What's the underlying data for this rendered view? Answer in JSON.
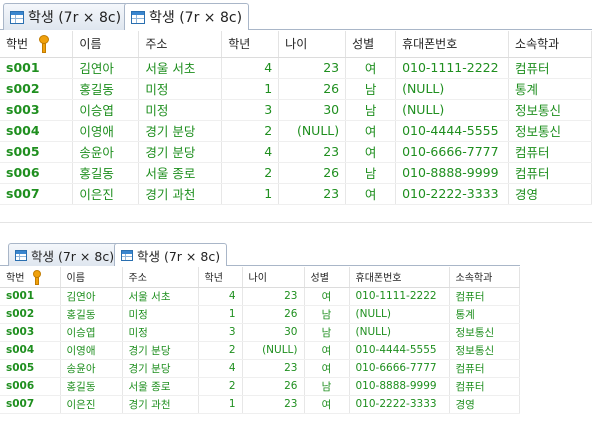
{
  "tabs": [
    {
      "label": "학생 (7r × 8c)",
      "active": false
    },
    {
      "label": "학생 (7r × 8c)",
      "active": true
    }
  ],
  "columns": [
    "학번",
    "이름",
    "주소",
    "학년",
    "나이",
    "성별",
    "휴대폰번호",
    "소속학과"
  ],
  "rows": [
    {
      "id": "s001",
      "name": "김연아",
      "address": "서울 서초",
      "grade": "4",
      "age": "23",
      "gender": "여",
      "phone": "010-1111-2222",
      "dept": "컴퓨터"
    },
    {
      "id": "s002",
      "name": "홍길동",
      "address": "미정",
      "grade": "1",
      "age": "26",
      "gender": "남",
      "phone": "(NULL)",
      "dept": "통계"
    },
    {
      "id": "s003",
      "name": "이승엽",
      "address": "미정",
      "grade": "3",
      "age": "30",
      "gender": "남",
      "phone": "(NULL)",
      "dept": "정보통신"
    },
    {
      "id": "s004",
      "name": "이영애",
      "address": "경기 분당",
      "grade": "2",
      "age": "(NULL)",
      "gender": "여",
      "phone": "010-4444-5555",
      "dept": "정보통신"
    },
    {
      "id": "s005",
      "name": "송윤아",
      "address": "경기 분당",
      "grade": "4",
      "age": "23",
      "gender": "여",
      "phone": "010-6666-7777",
      "dept": "컴퓨터"
    },
    {
      "id": "s006",
      "name": "홍길동",
      "address": "서울 종로",
      "grade": "2",
      "age": "26",
      "gender": "남",
      "phone": "010-8888-9999",
      "dept": "컴퓨터"
    },
    {
      "id": "s007",
      "name": "이은진",
      "address": "경기 과천",
      "grade": "1",
      "age": "23",
      "gender": "여",
      "phone": "010-2222-3333",
      "dept": "경영"
    }
  ],
  "colors": {
    "text_green": "#1f8f1f",
    "number_blue": "#1f22c8",
    "null_gray": "#a8a8b8",
    "tab_border": "#a9b6c8"
  },
  "icons": {
    "tab": "table-icon",
    "primary_key": "key-icon"
  }
}
